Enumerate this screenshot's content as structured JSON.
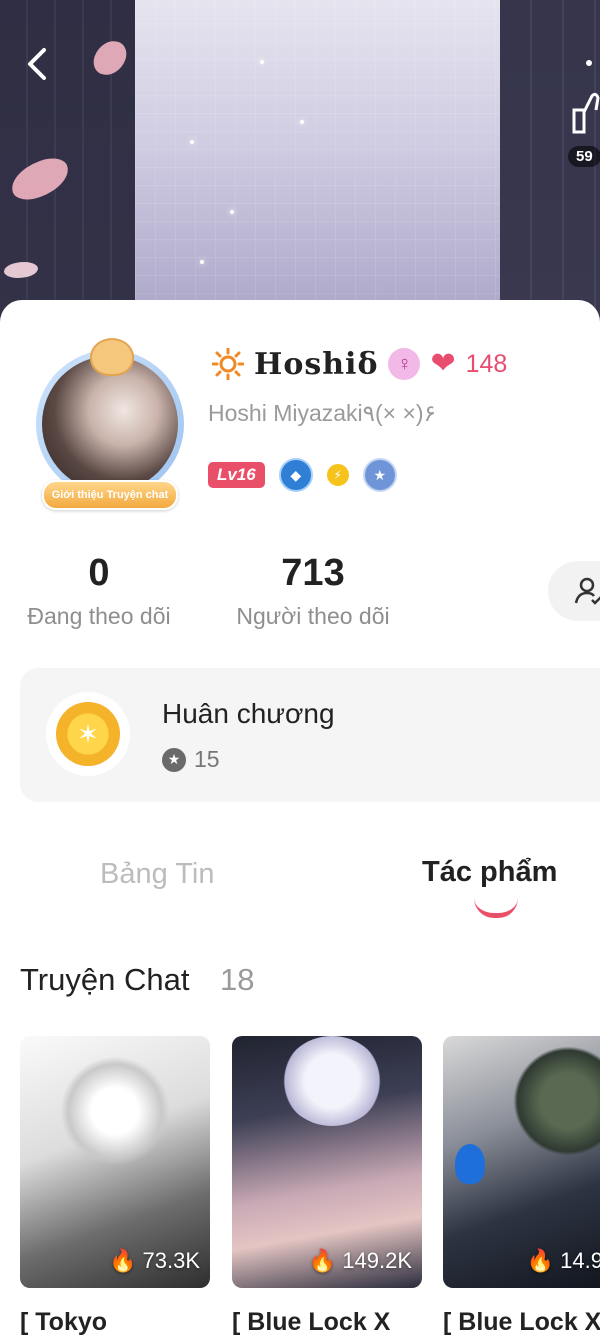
{
  "header": {
    "like_count": "59"
  },
  "profile": {
    "display_name": "Hoshiδ",
    "heart_count": "148",
    "username": "Hoshi Miyazaki٩(× ×)۶",
    "level": "Lv16",
    "intro_tag": "Giới thiệu Truyện chat"
  },
  "stats": {
    "following_count": "0",
    "following_label": "Đang theo dõi",
    "followers_count": "713",
    "followers_label": "Người theo dõi"
  },
  "medal": {
    "title": "Huân chương",
    "count": "15"
  },
  "tabs": [
    {
      "label": "Bảng Tin"
    },
    {
      "label": "Tác phẩm"
    }
  ],
  "section": {
    "title": "Truyện Chat",
    "count": "18"
  },
  "stories": [
    {
      "views": "73.3K",
      "title": "[ Tokyo"
    },
    {
      "views": "149.2K",
      "title": "[ Blue Lock X"
    },
    {
      "views": "14.9",
      "title": "[ Blue Lock X"
    }
  ],
  "colors": {
    "accent": "#ea4f6a",
    "heart": "#e84d70",
    "muted_text": "#8e8e8e"
  },
  "icons": [
    "back-arrow-icon",
    "thumbs-up-icon",
    "sun-icon",
    "female-icon",
    "heart-icon",
    "water-drop-icon",
    "lightning-icon",
    "hexagon-star-icon",
    "add-friend-icon",
    "medal-icon",
    "star-icon",
    "fire-icon"
  ]
}
